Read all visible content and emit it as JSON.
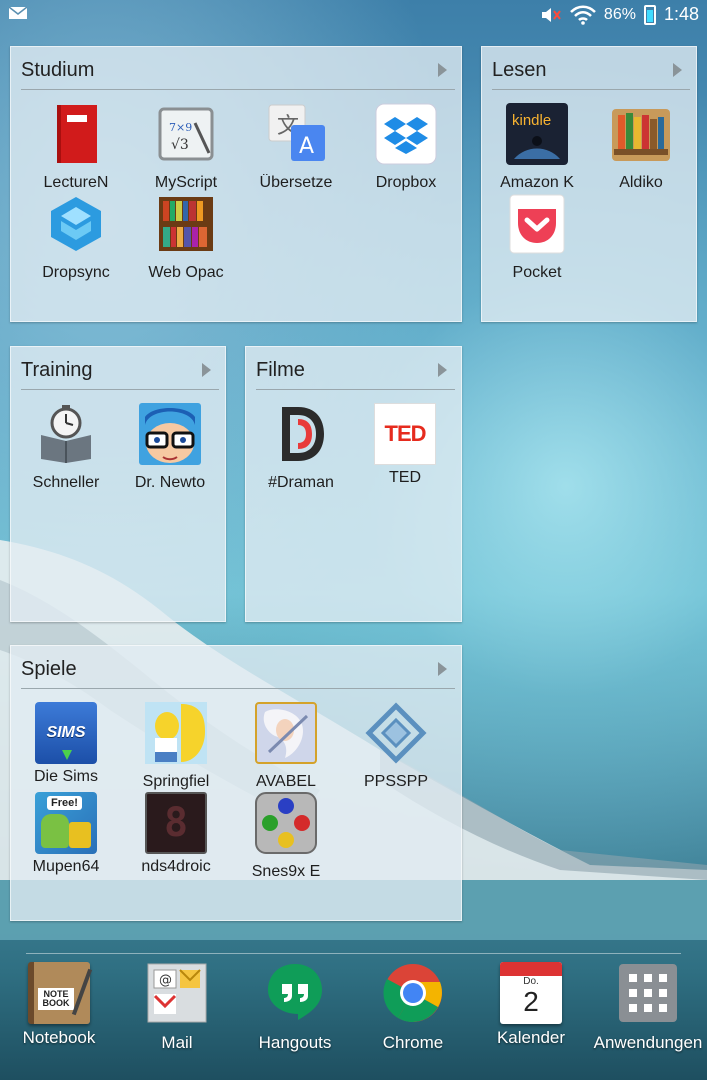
{
  "status_bar": {
    "battery": "86%",
    "time": "1:48",
    "icons": [
      "mail-icon",
      "mute-icon",
      "wifi-icon",
      "battery-icon"
    ]
  },
  "folders": {
    "studium": {
      "title": "Studium",
      "apps": [
        {
          "label": "LectureN",
          "icon": "notebook-red-icon"
        },
        {
          "label": "MyScript",
          "icon": "myscript-icon"
        },
        {
          "label": "Übersetze",
          "icon": "translate-icon"
        },
        {
          "label": "Dropbox",
          "icon": "dropbox-icon"
        },
        {
          "label": "Dropsync",
          "icon": "dropsync-icon"
        },
        {
          "label": "Web Opac",
          "icon": "books-shelf-icon"
        }
      ]
    },
    "lesen": {
      "title": "Lesen",
      "apps": [
        {
          "label": "Amazon K",
          "icon": "kindle-icon"
        },
        {
          "label": "Aldiko",
          "icon": "aldiko-icon"
        },
        {
          "label": "Pocket",
          "icon": "pocket-icon"
        }
      ]
    },
    "training": {
      "title": "Training",
      "apps": [
        {
          "label": "Schneller",
          "icon": "stopwatch-book-icon"
        },
        {
          "label": "Dr. Newto",
          "icon": "dr-newton-icon"
        }
      ]
    },
    "filme": {
      "title": "Filme",
      "apps": [
        {
          "label": "#Draman",
          "icon": "dramanet-icon"
        },
        {
          "label": "TED",
          "icon": "ted-icon",
          "text": "TED"
        }
      ]
    },
    "spiele": {
      "title": "Spiele",
      "apps": [
        {
          "label": "Die Sims",
          "icon": "sims-icon",
          "text": "SIMS"
        },
        {
          "label": "Springfiel",
          "icon": "springfield-icon"
        },
        {
          "label": "AVABEL",
          "icon": "avabel-icon"
        },
        {
          "label": "PPSSPP",
          "icon": "ppsspp-icon"
        },
        {
          "label": "Mupen64",
          "icon": "mupen64-icon",
          "text": "Free!"
        },
        {
          "label": "nds4droic",
          "icon": "nds4droid-icon",
          "text": "8"
        },
        {
          "label": "Snes9x E",
          "icon": "snes9x-icon"
        }
      ]
    }
  },
  "dock": [
    {
      "label": "Notebook",
      "icon": "notebook-icon",
      "text": "NOTE BOOK"
    },
    {
      "label": "Mail",
      "icon": "mail-app-icon"
    },
    {
      "label": "Hangouts",
      "icon": "hangouts-icon"
    },
    {
      "label": "Chrome",
      "icon": "chrome-icon"
    },
    {
      "label": "Kalender",
      "icon": "calendar-icon",
      "day": "Do.",
      "date": "2"
    },
    {
      "label": "Anwendungen",
      "icon": "app-drawer-icon"
    }
  ],
  "colors": {
    "folder_bg": "#e1ecf2",
    "dropbox_blue": "#1f8ce6",
    "ted_red": "#e62b1e",
    "pocket_red": "#ee4056",
    "hangouts_green": "#0f9d58"
  }
}
